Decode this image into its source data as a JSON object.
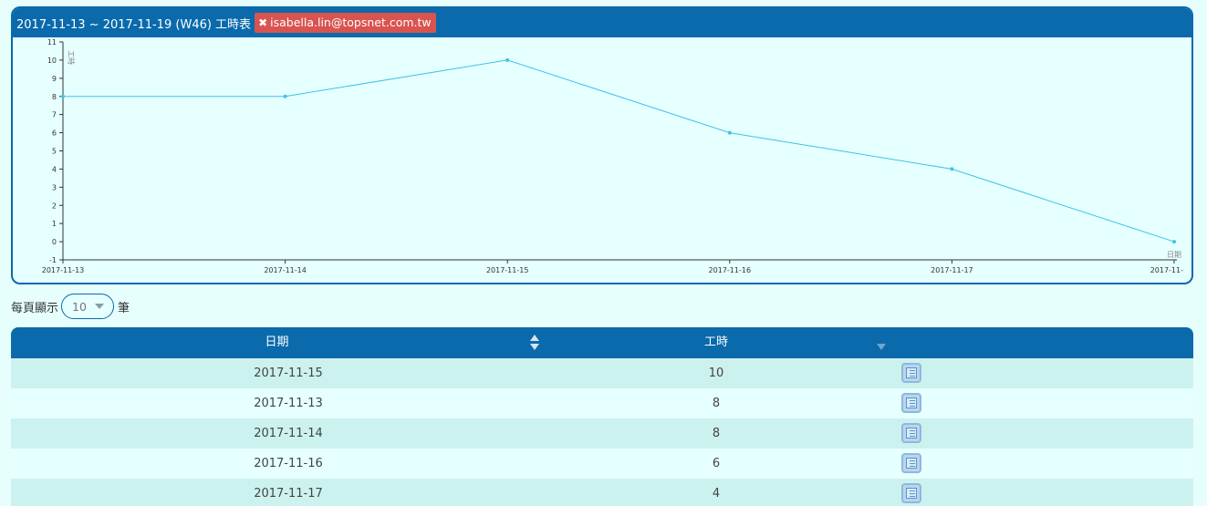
{
  "header": {
    "title": "2017-11-13 ~ 2017-11-19 (W46) 工時表",
    "user_tag": "isabella.lin@topsnet.com.tw",
    "remove_icon": "times-icon"
  },
  "chart_data": {
    "type": "line",
    "x": [
      "2017-11-13",
      "2017-11-14",
      "2017-11-15",
      "2017-11-16",
      "2017-11-17",
      "2017-11-"
    ],
    "series": [
      {
        "values": [
          8,
          8,
          10,
          6,
          4,
          0
        ]
      }
    ],
    "ylabel": "工時",
    "xlabel": "日期",
    "ylim": [
      -1,
      11
    ],
    "yticks": [
      "-1",
      "0",
      "1",
      "2",
      "3",
      "4",
      "5",
      "6",
      "7",
      "8",
      "9",
      "10",
      "11"
    ],
    "grid": false,
    "line_color": "#3ec2e8"
  },
  "page_size": {
    "prefix": "每頁顯示",
    "value": "10",
    "suffix": "筆"
  },
  "table": {
    "headers": {
      "date": "日期",
      "hours": "工時"
    },
    "sort_icon": "sort-icon",
    "row_icon": "list-detail-icon",
    "rows": [
      {
        "date": "2017-11-15",
        "hours": "10"
      },
      {
        "date": "2017-11-13",
        "hours": "8"
      },
      {
        "date": "2017-11-14",
        "hours": "8"
      },
      {
        "date": "2017-11-16",
        "hours": "6"
      },
      {
        "date": "2017-11-17",
        "hours": "4"
      }
    ]
  },
  "colors": {
    "primary": "#0a6aac",
    "tag_red": "#d9534f",
    "background": "#e6ffff",
    "row_alt": "#ccf2ef"
  }
}
